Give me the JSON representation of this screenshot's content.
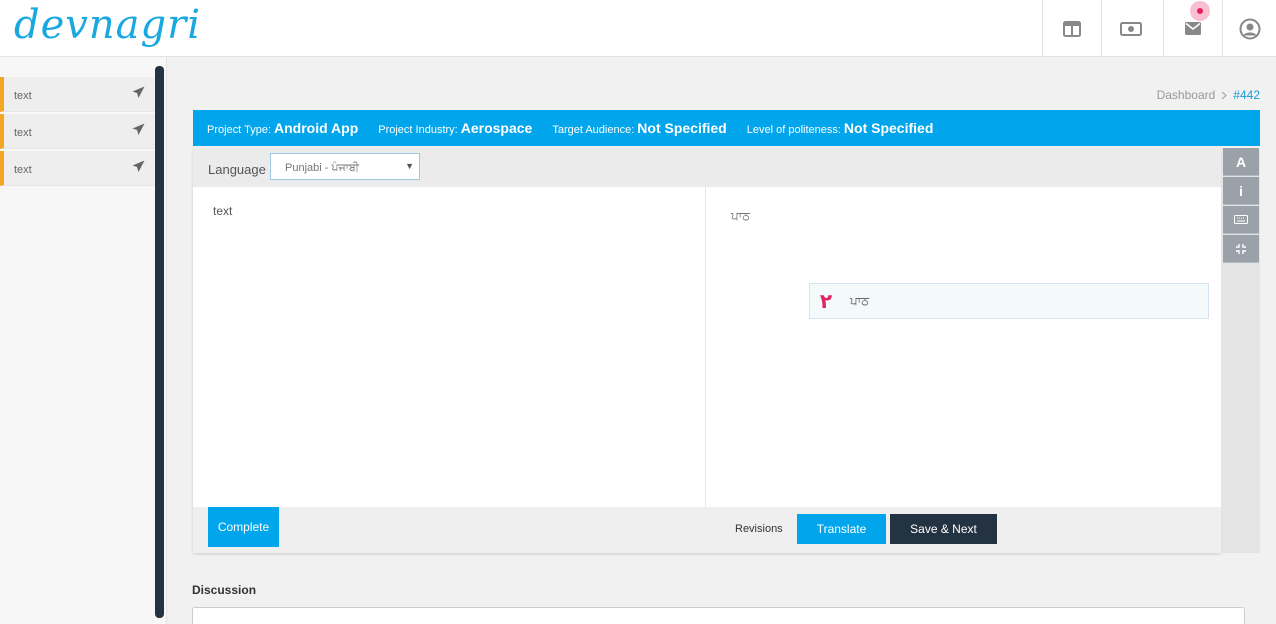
{
  "header": {
    "logo_text": "devnagri",
    "icons": [
      "layout-icon",
      "money-icon",
      "mail-icon",
      "user-icon"
    ]
  },
  "sidebar": {
    "items": [
      {
        "label": "text"
      },
      {
        "label": "text"
      },
      {
        "label": "text"
      }
    ]
  },
  "breadcrumb": {
    "root": "Dashboard",
    "current": "#442"
  },
  "project_info": {
    "type_label": "Project Type:",
    "type_value": "Android App",
    "industry_label": "Project Industry:",
    "industry_value": "Aerospace",
    "audience_label": "Target Audience:",
    "audience_value": "Not Specified",
    "politeness_label": "Level of politeness:",
    "politeness_value": "Not Specified"
  },
  "editor": {
    "language_label": "Language",
    "language_selected": "Punjabi - ਪੰਜਾਬੀ",
    "source_text": "text",
    "target_text": "ਪਾਠ",
    "suggestion": {
      "number": "٢",
      "text": "ਪਾਠ"
    },
    "complete_label": "Complete",
    "revisions_label": "Revisions",
    "translate_label": "Translate",
    "save_next_label": "Save & Next"
  },
  "tools": {
    "font_label": "A",
    "info_label": "i"
  },
  "discussion": {
    "title": "Discussion"
  },
  "colors": {
    "primary": "#00a5ec",
    "dark": "#243341",
    "accent": "#f5a623",
    "notification": "#e0245e"
  }
}
